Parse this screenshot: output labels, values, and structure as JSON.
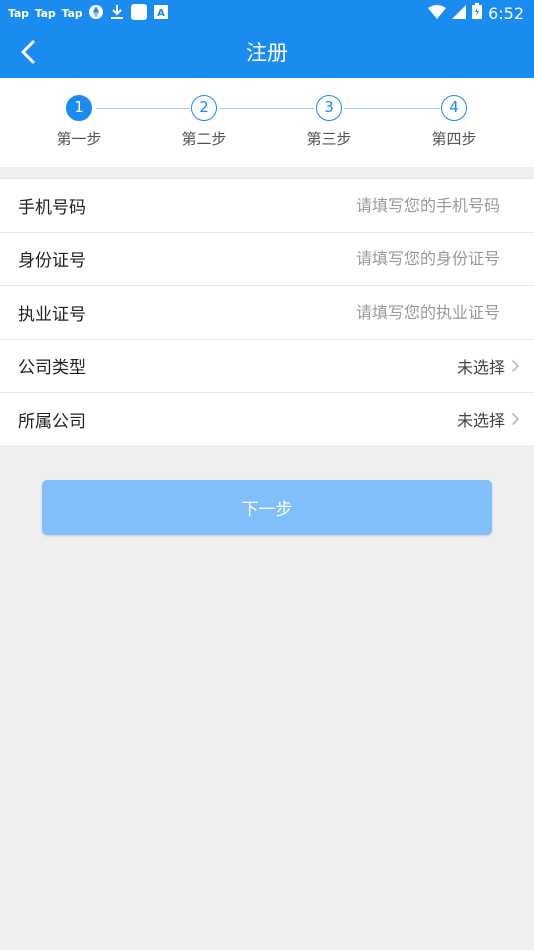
{
  "status_bar": {
    "notifications": [
      "Tap",
      "Tap",
      "Tap"
    ],
    "time": "6:52",
    "icons": [
      "aperture-icon",
      "download-icon",
      "square-icon",
      "a-box-icon",
      "wifi-icon",
      "signal-icon",
      "battery-icon"
    ]
  },
  "header": {
    "title": "注册",
    "back_icon": "chevron-left-icon"
  },
  "stepper": {
    "steps": [
      {
        "number": "1",
        "label": "第一步",
        "active": true
      },
      {
        "number": "2",
        "label": "第二步",
        "active": false
      },
      {
        "number": "3",
        "label": "第三步",
        "active": false
      },
      {
        "number": "4",
        "label": "第四步",
        "active": false
      }
    ]
  },
  "form": {
    "phone": {
      "label": "手机号码",
      "placeholder": "请填写您的手机号码",
      "value": ""
    },
    "id_number": {
      "label": "身份证号",
      "placeholder": "请填写您的身份证号",
      "value": ""
    },
    "license": {
      "label": "执业证号",
      "placeholder": "请填写您的执业证号",
      "value": ""
    },
    "company_type": {
      "label": "公司类型",
      "value": "未选择"
    },
    "company": {
      "label": "所属公司",
      "value": "未选择"
    }
  },
  "next_button": {
    "label": "下一步"
  },
  "colors": {
    "primary": "#1a8cf0",
    "button_disabled": "#80bffb",
    "background": "#efefef"
  }
}
